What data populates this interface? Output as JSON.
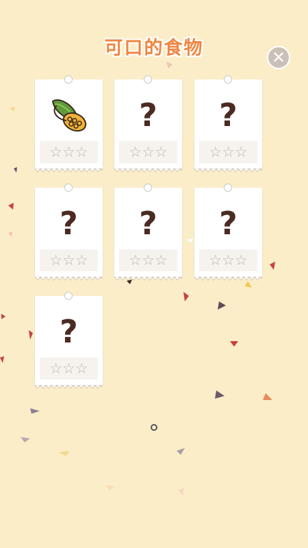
{
  "title": "可口的食物",
  "close_icon": "close-icon",
  "cards": [
    {
      "locked": false,
      "icon": "corn-icon",
      "stars": "☆☆☆"
    },
    {
      "locked": true,
      "symbol": "?",
      "stars": "☆☆☆"
    },
    {
      "locked": true,
      "symbol": "?",
      "stars": "☆☆☆"
    },
    {
      "locked": true,
      "symbol": "?",
      "stars": "☆☆☆"
    },
    {
      "locked": true,
      "symbol": "?",
      "stars": "☆☆☆"
    },
    {
      "locked": true,
      "symbol": "?",
      "stars": "☆☆☆"
    },
    {
      "locked": true,
      "symbol": "?",
      "stars": "☆☆☆"
    }
  ],
  "colors": {
    "background": "#fcedc9",
    "title": "#ef8641",
    "question": "#4b2b23",
    "star": "#b9b4ac"
  }
}
